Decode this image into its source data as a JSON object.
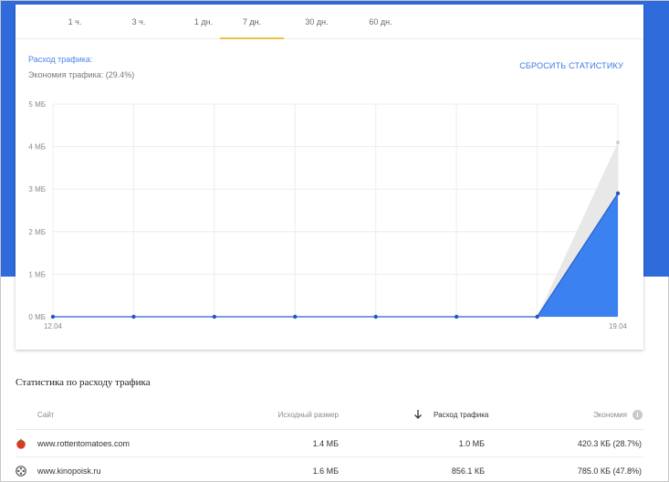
{
  "tabs": [
    {
      "label": "1 ч."
    },
    {
      "label": "3 ч."
    },
    {
      "label": "1 дн."
    },
    {
      "label": "7 дн."
    },
    {
      "label": "30 дн."
    },
    {
      "label": "60 дн."
    }
  ],
  "active_tab_index": 3,
  "legend": {
    "usage": "Расход трафика:",
    "savings": "Экономия трафика: (29.4%)"
  },
  "reset_button": "СБРОСИТЬ СТАТИСТИКУ",
  "colors": {
    "header_band": "#2f6bdb",
    "usage_area": "#3b82f0",
    "savings_area": "#e8e8e8",
    "tab_indicator": "#f0c049",
    "link": "#3b78e7"
  },
  "chart_data": {
    "type": "area",
    "x": [
      "12.04",
      "13.04",
      "14.04",
      "15.04",
      "16.04",
      "17.04",
      "18.04",
      "19.04"
    ],
    "x_tick_labels": [
      "12.04",
      "19.04"
    ],
    "y_tick_labels": [
      "0 МБ",
      "1 МБ",
      "2 МБ",
      "3 МБ",
      "4 МБ",
      "5 МБ"
    ],
    "ylim": [
      0,
      5
    ],
    "grid": true,
    "series": [
      {
        "name": "Расход трафика",
        "values": [
          0,
          0,
          0,
          0,
          0,
          0,
          0,
          2.9
        ]
      },
      {
        "name": "Экономия трафика",
        "values": [
          0,
          0,
          0,
          0,
          0,
          0,
          0,
          4.1
        ]
      }
    ]
  },
  "stats": {
    "title": "Статистика по расходу трафика",
    "columns": {
      "site": "Сайт",
      "original": "Исходный размер",
      "usage": "Расход трафика",
      "savings": "Экономия"
    },
    "rows": [
      {
        "site": "www.rottentomatoes.com",
        "icon": "tomato-icon",
        "original": "1.4 МБ",
        "usage": "1.0 МБ",
        "savings": "420.3 КБ (28.7%)"
      },
      {
        "site": "www.kinopoisk.ru",
        "icon": "film-reel-icon",
        "original": "1.6 МБ",
        "usage": "856.1 КБ",
        "savings": "785.0 КБ (47.8%)"
      }
    ]
  }
}
